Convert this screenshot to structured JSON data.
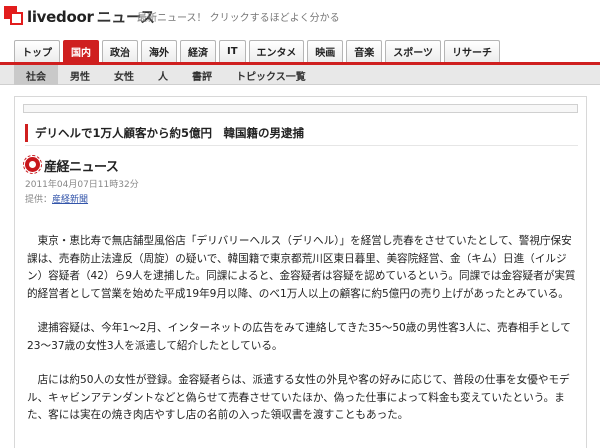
{
  "header": {
    "logo_main": "livedoor",
    "logo_suffix": "ニュース",
    "tagline": "最新ニュース！ クリックするほどよく分かる"
  },
  "category_tabs": [
    {
      "label": "トップ",
      "active": false
    },
    {
      "label": "国内",
      "active": true
    },
    {
      "label": "政治",
      "active": false
    },
    {
      "label": "海外",
      "active": false
    },
    {
      "label": "経済",
      "active": false
    },
    {
      "label": "IT",
      "active": false
    },
    {
      "label": "エンタメ",
      "active": false
    },
    {
      "label": "映画",
      "active": false
    },
    {
      "label": "音楽",
      "active": false
    },
    {
      "label": "スポーツ",
      "active": false
    },
    {
      "label": "リサーチ",
      "active": false
    }
  ],
  "sub_tabs": [
    {
      "label": "社会",
      "active": true
    },
    {
      "label": "男性",
      "active": false
    },
    {
      "label": "女性",
      "active": false
    },
    {
      "label": "人",
      "active": false
    },
    {
      "label": "書評",
      "active": false
    },
    {
      "label": "トピックス一覧",
      "active": false
    }
  ],
  "article": {
    "headline": "デリヘルで1万人顧客から約5億円　韓国籍の男逮捕",
    "source_name": "産経ニュース",
    "date": "2011年04月07日11時32分",
    "provider_label": "提供：",
    "provider_name": "産経新聞",
    "paragraphs": [
      "東京・恵比寿で無店舗型風俗店「デリバリーヘルス（デリヘル）」を経営し売春をさせていたとして、警視庁保安課は、売春防止法違反（周旋）の疑いで、韓国籍で東京都荒川区東日暮里、美容院経営、金（キム）日進（イルジン）容疑者（42）ら9人を逮捕した。同課によると、金容疑者は容疑を認めているという。同課では金容疑者が実質的経営者として営業を始めた平成19年9月以降、のべ1万人以上の顧客に約5億円の売り上げがあったとみている。",
      "逮捕容疑は、今年1～2月、インターネットの広告をみて連絡してきた35～50歳の男性客3人に、売春相手として23～37歳の女性3人を派遣して紹介したとしている。",
      "店には約50人の女性が登録。金容疑者らは、派遣する女性の外見や客の好みに応じて、普段の仕事を女優やモデル、キャビンアテンダントなどと偽らせて売春させていたほか、偽った仕事によって料金も変えていたという。また、客には実在の焼き肉店やすし店の名前の入った領収書を渡すこともあった。"
    ]
  },
  "colors": {
    "brand_red": "#cf1f1f",
    "link_blue": "#3355aa"
  }
}
